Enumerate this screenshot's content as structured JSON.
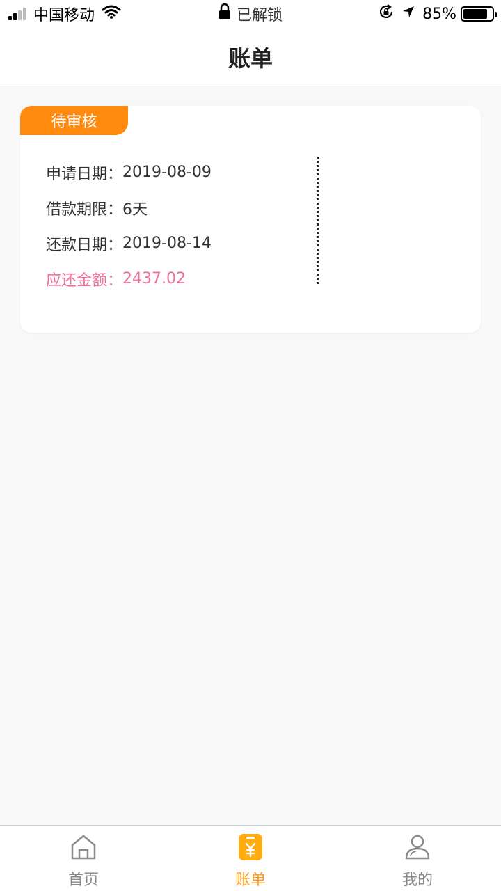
{
  "status_bar": {
    "carrier": "中国移动",
    "lock_text": "已解锁",
    "battery_percent": "85%",
    "battery_level": 0.85
  },
  "nav": {
    "title": "账单"
  },
  "bill_card": {
    "status_tag": "待审核",
    "rows": [
      {
        "label": "申请日期：",
        "value": "2019-08-09"
      },
      {
        "label": "借款期限：",
        "value": "6天"
      },
      {
        "label": "还款日期：",
        "value": "2019-08-14"
      },
      {
        "label": "应还金额：",
        "value": "2437.02"
      }
    ]
  },
  "tab_bar": {
    "items": [
      {
        "label": "首页",
        "icon": "home-icon",
        "active": false
      },
      {
        "label": "账单",
        "icon": "bill-yen-icon",
        "active": true
      },
      {
        "label": "我的",
        "icon": "person-icon",
        "active": false
      }
    ]
  },
  "colors": {
    "accent_orange": "#ff8a0d",
    "tab_active": "#ff9a1a",
    "amount_pink": "#ef6e9a"
  }
}
